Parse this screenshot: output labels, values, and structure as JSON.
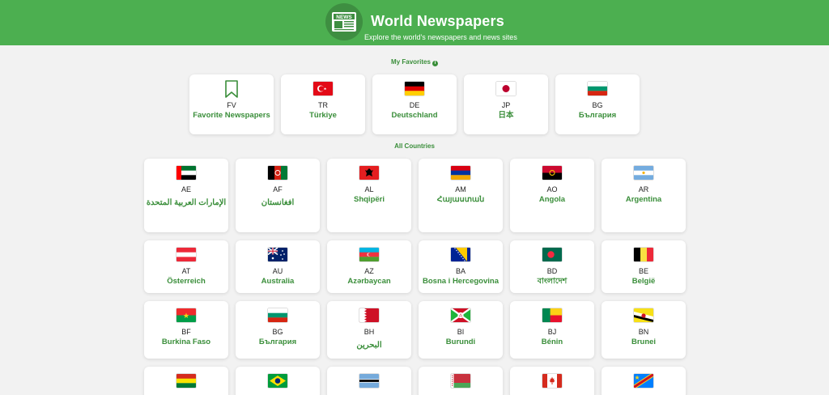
{
  "header": {
    "title": "World Newspapers",
    "subtitle": "Explore the world's newspapers and news sites",
    "logo_text": "NEWS"
  },
  "favorites": {
    "title": "My Favorites",
    "info_icon": "info-icon",
    "items": [
      {
        "code": "FV",
        "name": "Favorite Newspapers",
        "icon": "bookmark-icon"
      },
      {
        "code": "TR",
        "name": "Türkiye"
      },
      {
        "code": "DE",
        "name": "Deutschland"
      },
      {
        "code": "JP",
        "name": "日本"
      },
      {
        "code": "BG",
        "name": "България"
      }
    ]
  },
  "countries": {
    "title": "All Countries",
    "items": [
      {
        "code": "AE",
        "name": "الإمارات العربية المتحدة"
      },
      {
        "code": "AF",
        "name": "افغانستان"
      },
      {
        "code": "AL",
        "name": "Shqipëri"
      },
      {
        "code": "AM",
        "name": "Հայաստան"
      },
      {
        "code": "AO",
        "name": "Angola"
      },
      {
        "code": "AR",
        "name": "Argentina"
      },
      {
        "code": "AT",
        "name": "Österreich"
      },
      {
        "code": "AU",
        "name": "Australia"
      },
      {
        "code": "AZ",
        "name": "Azərbaycan"
      },
      {
        "code": "BA",
        "name": "Bosna i Hercegovina"
      },
      {
        "code": "BD",
        "name": "বাংলাদেশ"
      },
      {
        "code": "BE",
        "name": "België"
      },
      {
        "code": "BF",
        "name": "Burkina Faso"
      },
      {
        "code": "BG",
        "name": "България"
      },
      {
        "code": "BH",
        "name": "البحرين"
      },
      {
        "code": "BI",
        "name": "Burundi"
      },
      {
        "code": "BJ",
        "name": "Bénin"
      },
      {
        "code": "BN",
        "name": "Brunei"
      }
    ]
  },
  "colors": {
    "header_green": "#4caf50",
    "accent_green": "#3a8e3a",
    "background": "#f2f2f2"
  }
}
